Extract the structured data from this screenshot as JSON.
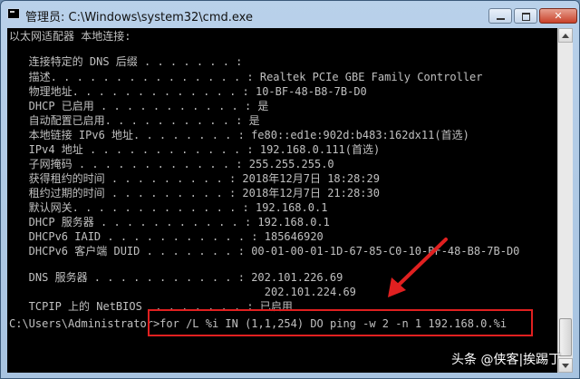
{
  "window": {
    "title": "管理员: C:\\Windows\\system32\\cmd.exe"
  },
  "console": {
    "lines": [
      "以太网适配器 本地连接:",
      "",
      "   连接特定的 DNS 后缀 . . . . . . . :",
      "   描述. . . . . . . . . . . . . . . : Realtek PCIe GBE Family Controller",
      "   物理地址. . . . . . . . . . . . . : 10-BF-48-B8-7B-D0",
      "   DHCP 已启用 . . . . . . . . . . . : 是",
      "   自动配置已启用. . . . . . . . . . : 是",
      "   本地链接 IPv6 地址. . . . . . . . : fe80::ed1e:902d:b483:162dx11(首选)",
      "   IPv4 地址 . . . . . . . . . . . . : 192.168.0.111(首选)",
      "   子网掩码 . . . . . . . . . . . . : 255.255.255.0",
      "   获得租约的时间 . . . . . . . . . : 2018年12月7日 18:28:29",
      "   租约过期的时间 . . . . . . . . . : 2018年12月7日 21:28:30",
      "   默认网关. . . . . . . . . . . . . : 192.168.0.1",
      "   DHCP 服务器 . . . . . . . . . . . : 192.168.0.1",
      "   DHCPv6 IAID . . . . . . . . . . . : 185646920",
      "   DHCPv6 客户端 DUID . . . . . . . : 00-01-00-01-1D-67-85-C0-10-BF-48-B8-7B-D0",
      "",
      "   DNS 服务器 . . . . . . . . . . . : 202.101.226.69",
      "                                       202.101.224.69",
      "   TCPIP 上的 NetBIOS  . . . . . . . : 已启用",
      "",
      "C:\\Users\\Administrator>for /L %i IN (1,1,254) DO ping -w 2 -n 1 192.168.0.%i"
    ]
  },
  "watermark": "头条 @侠客|挨踢丁",
  "colors": {
    "console_bg": "#000000",
    "console_text": "#c0c0c0",
    "annotation": "#e02020"
  }
}
